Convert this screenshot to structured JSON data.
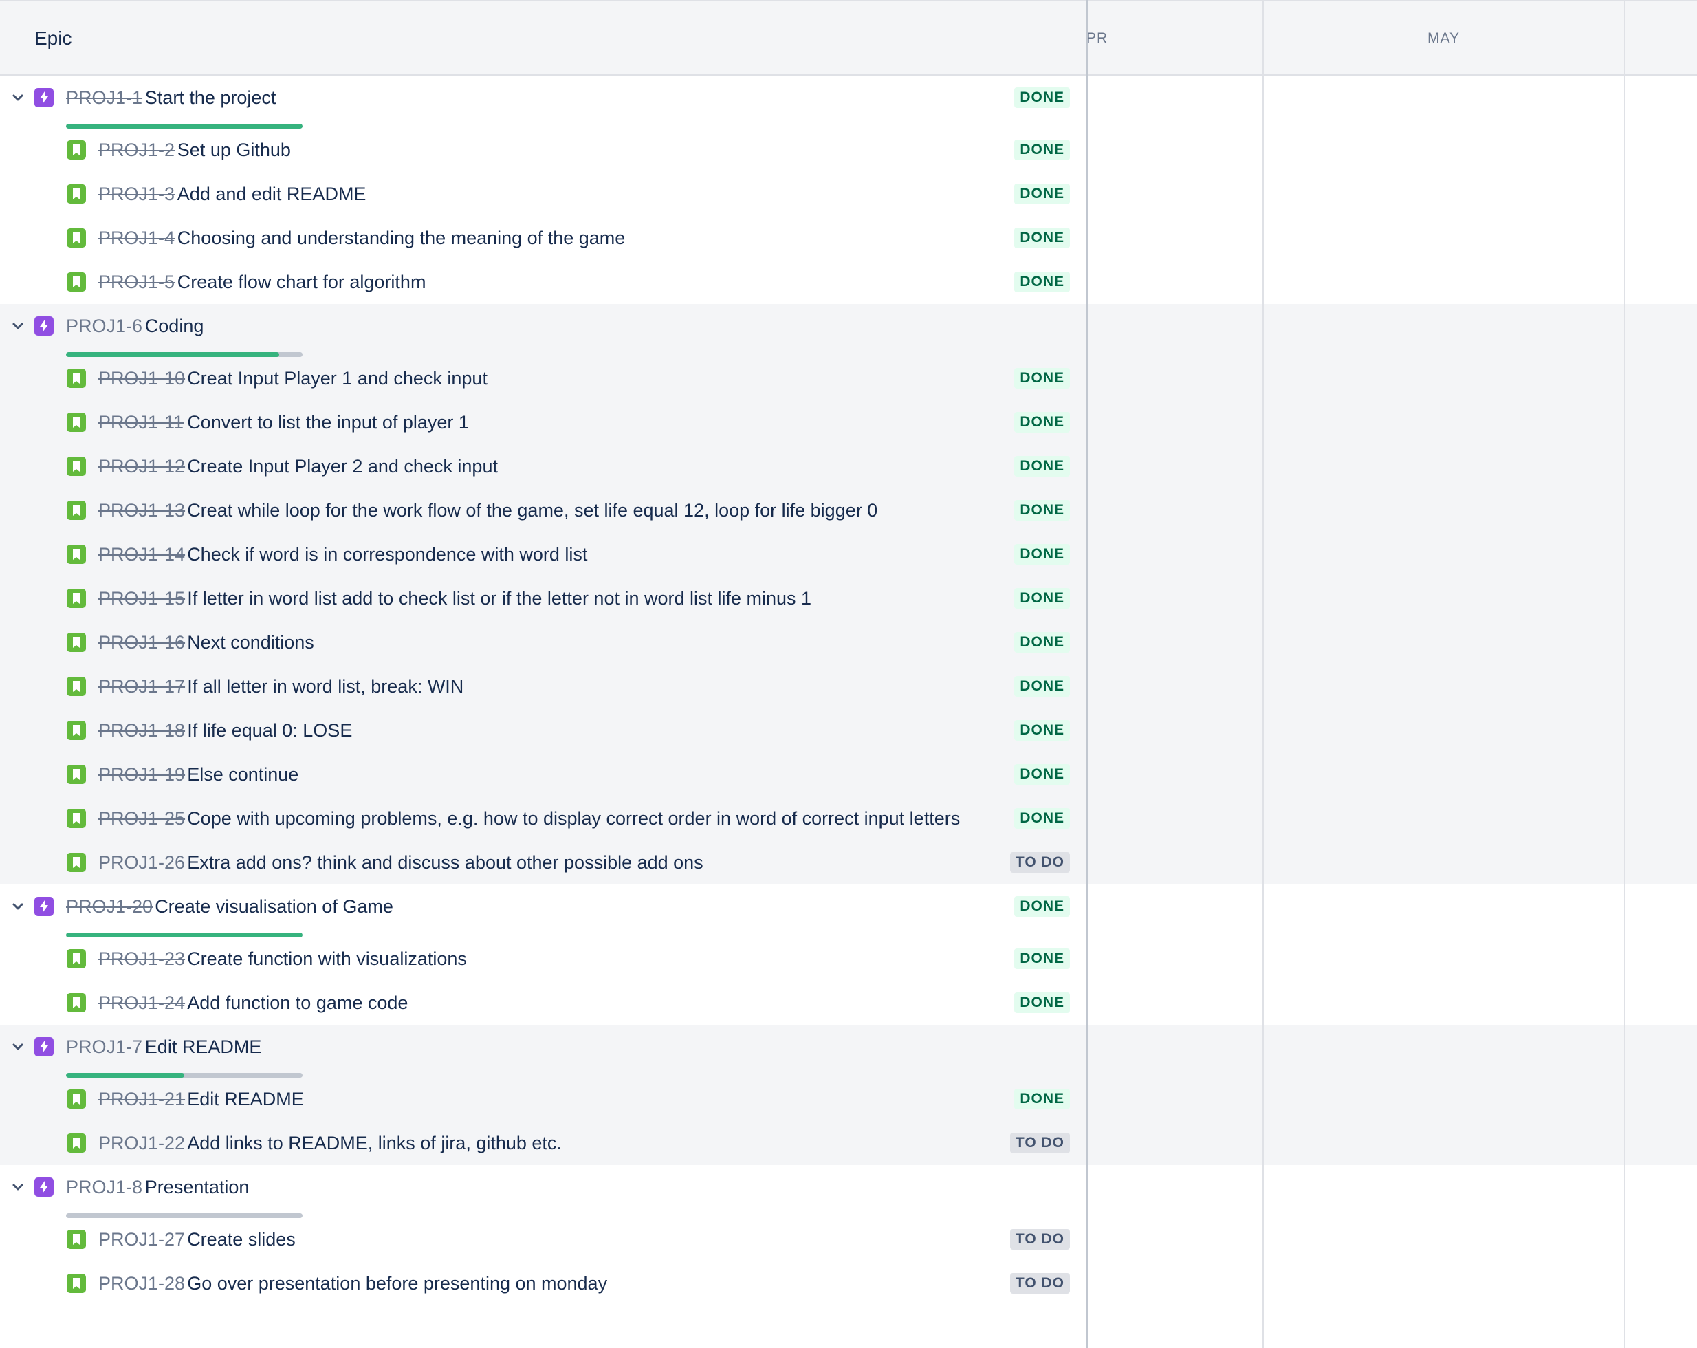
{
  "header": {
    "epic_label": "Epic",
    "months": [
      "PR",
      "MAY"
    ]
  },
  "colors": {
    "done_text": "#006644",
    "done_bg": "#e3fcef",
    "todo_text": "#42526e",
    "todo_bg": "#dfe1e6",
    "epic_icon": "#904ee2",
    "story_icon": "#63ba3c",
    "progress_fill": "#36b37e"
  },
  "epics": [
    {
      "key": "PROJ1-1",
      "summary": "Start the project",
      "status": "DONE",
      "key_done": true,
      "progress": 1.0,
      "icon": "epic-lightning-icon",
      "children": [
        {
          "key": "PROJ1-2",
          "summary": "Set up Github",
          "status": "DONE",
          "key_done": true
        },
        {
          "key": "PROJ1-3",
          "summary": "Add and edit README",
          "status": "DONE",
          "key_done": true
        },
        {
          "key": "PROJ1-4",
          "summary": "Choosing and understanding the meaning of the game",
          "status": "DONE",
          "key_done": true
        },
        {
          "key": "PROJ1-5",
          "summary": "Create flow chart for algorithm",
          "status": "DONE",
          "key_done": true
        }
      ]
    },
    {
      "key": "PROJ1-6",
      "summary": "Coding",
      "status": "",
      "key_done": false,
      "progress": 0.9,
      "icon": "epic-lightning-icon",
      "children": [
        {
          "key": "PROJ1-10",
          "summary": "Creat Input Player 1 and check input",
          "status": "DONE",
          "key_done": true
        },
        {
          "key": "PROJ1-11",
          "summary": "Convert to list the input of player 1",
          "status": "DONE",
          "key_done": true
        },
        {
          "key": "PROJ1-12",
          "summary": "Create Input Player 2 and check input",
          "status": "DONE",
          "key_done": true
        },
        {
          "key": "PROJ1-13",
          "summary": "Creat while loop for the work flow of the game, set life equal 12, loop for life bigger 0",
          "status": "DONE",
          "key_done": true
        },
        {
          "key": "PROJ1-14",
          "summary": "Check if word is in correspondence with word list",
          "status": "DONE",
          "key_done": true
        },
        {
          "key": "PROJ1-15",
          "summary": "If letter in word list add to check list or if the letter not in word list life minus 1",
          "status": "DONE",
          "key_done": true
        },
        {
          "key": "PROJ1-16",
          "summary": "Next conditions",
          "status": "DONE",
          "key_done": true
        },
        {
          "key": "PROJ1-17",
          "summary": "If all letter in word list, break: WIN",
          "status": "DONE",
          "key_done": true
        },
        {
          "key": "PROJ1-18",
          "summary": "If life equal 0: LOSE",
          "status": "DONE",
          "key_done": true
        },
        {
          "key": "PROJ1-19",
          "summary": "Else continue",
          "status": "DONE",
          "key_done": true
        },
        {
          "key": "PROJ1-25",
          "summary": "Cope with upcoming problems, e.g. how to display correct order in word of correct input letters",
          "status": "DONE",
          "key_done": true
        },
        {
          "key": "PROJ1-26",
          "summary": "Extra add ons? think and discuss about other possible add ons",
          "status": "TO DO",
          "key_done": false
        }
      ]
    },
    {
      "key": "PROJ1-20",
      "summary": "Create visualisation of Game",
      "status": "DONE",
      "key_done": true,
      "progress": 1.0,
      "icon": "epic-lightning-icon",
      "children": [
        {
          "key": "PROJ1-23",
          "summary": "Create function with visualizations",
          "status": "DONE",
          "key_done": true
        },
        {
          "key": "PROJ1-24",
          "summary": "Add function to game code",
          "status": "DONE",
          "key_done": true
        }
      ]
    },
    {
      "key": "PROJ1-7",
      "summary": "Edit README",
      "status": "",
      "key_done": false,
      "progress": 0.5,
      "icon": "epic-lightning-icon",
      "children": [
        {
          "key": "PROJ1-21",
          "summary": "Edit README",
          "status": "DONE",
          "key_done": true
        },
        {
          "key": "PROJ1-22",
          "summary": "Add links to README, links of jira, github etc.",
          "status": "TO DO",
          "key_done": false
        }
      ]
    },
    {
      "key": "PROJ1-8",
      "summary": "Presentation",
      "status": "",
      "key_done": false,
      "progress": 0.0,
      "icon": "epic-lightning-icon",
      "children": [
        {
          "key": "PROJ1-27",
          "summary": "Create slides",
          "status": "TO DO",
          "key_done": false
        },
        {
          "key": "PROJ1-28",
          "summary": "Go over presentation before presenting on monday",
          "status": "TO DO",
          "key_done": false
        }
      ]
    }
  ]
}
